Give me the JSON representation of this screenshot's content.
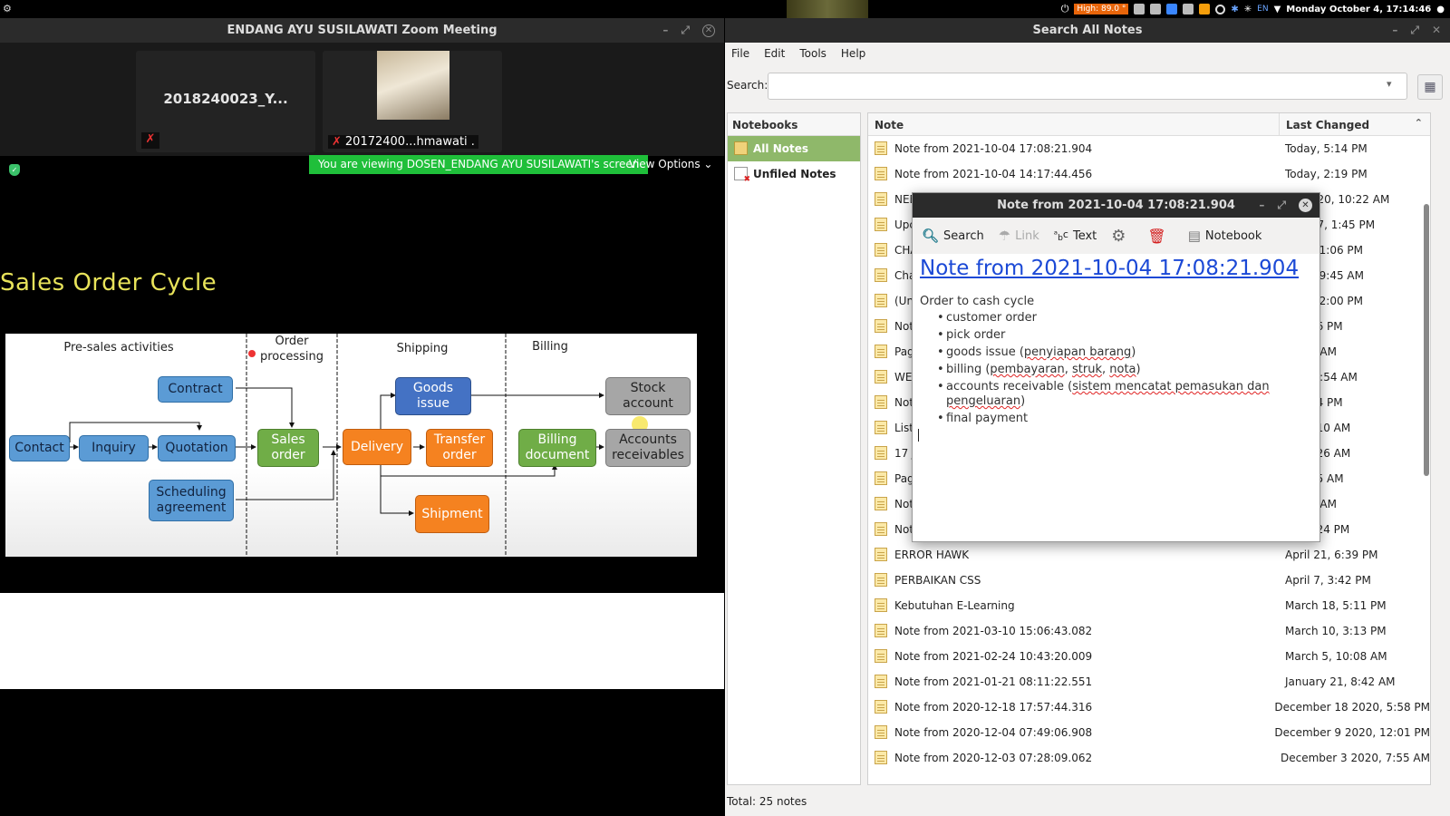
{
  "topbar": {
    "temp": "High: 89.0 °",
    "lang": "EN",
    "clock": "Monday October 4, 17:14:46"
  },
  "zoom": {
    "title": "ENDANG AYU SUSILAWATI  Zoom Meeting",
    "participant1": "2018240023_Y...",
    "participant2": "20172400...hmawati .",
    "viewing_banner": "You are viewing DOSEN_ENDANG AYU SUSILAWATI's screen",
    "view_options": "View Options",
    "slide_title": "Sales Order Cycle"
  },
  "diagram": {
    "lanes": [
      "Pre-sales activities",
      "Order processing",
      "Shipping",
      "Billing"
    ],
    "boxes": {
      "contract": "Contract",
      "contact": "Contact",
      "inquiry": "Inquiry",
      "quotation": "Quotation",
      "scheduling": "Scheduling agreement",
      "sales_order": "Sales order",
      "delivery": "Delivery",
      "goods_issue": "Goods issue",
      "transfer_order": "Transfer order",
      "shipment": "Shipment",
      "billing_doc": "Billing document",
      "stock_account": "Stock account",
      "accounts_recv": "Accounts receivables"
    }
  },
  "notes": {
    "title": "Search All Notes",
    "menu": [
      "File",
      "Edit",
      "Tools",
      "Help"
    ],
    "search_label": "Search:",
    "search_value": "",
    "notebooks_header": "Notebooks",
    "notebooks": [
      "All Notes",
      "Unfiled Notes"
    ],
    "col_note": "Note",
    "col_changed": "Last Changed",
    "rows": [
      {
        "title": "Note from 2021-10-04 17:08:21.904",
        "date": "Today, 5:14 PM"
      },
      {
        "title": "Note from 2021-10-04 14:17:44.456",
        "date": "Today, 2:19 PM"
      },
      {
        "title": "NEE",
        "date": "mber 20, 10:22 AM"
      },
      {
        "title": "Upc",
        "date": "mber 7, 1:45 PM"
      },
      {
        "title": "CHA",
        "date": "st 18, 1:06 PM"
      },
      {
        "title": "Cha",
        "date": "st 12, 9:45 AM"
      },
      {
        "title": "(Un",
        "date": "st 10, 2:00 PM"
      },
      {
        "title": "Not",
        "date": "3, 4:36 PM"
      },
      {
        "title": "Pag",
        "date": "10:54 AM"
      },
      {
        "title": "WE",
        "date": "29, 10:54 AM"
      },
      {
        "title": "Not",
        "date": "9, 8:14 PM"
      },
      {
        "title": "List",
        "date": "8, 11:10 AM"
      },
      {
        "title": "17 J",
        "date": "7, 10:26 AM"
      },
      {
        "title": "Pag",
        "date": "7, 8:35 AM"
      },
      {
        "title": "Not",
        "date": ", 9:33 AM"
      },
      {
        "title": "Not",
        "date": "28, 4:24 PM"
      },
      {
        "title": "ERROR HAWK",
        "date": "April 21, 6:39 PM"
      },
      {
        "title": "PERBAIKAN CSS",
        "date": "April 7, 3:42 PM"
      },
      {
        "title": "Kebutuhan E-Learning",
        "date": "March 18, 5:11 PM"
      },
      {
        "title": "Note from 2021-03-10 15:06:43.082",
        "date": "March 10, 3:13 PM"
      },
      {
        "title": "Note from 2021-02-24 10:43:20.009",
        "date": "March 5, 10:08 AM"
      },
      {
        "title": "Note from 2021-01-21 08:11:22.551",
        "date": "January 21, 8:42 AM"
      },
      {
        "title": "Note from 2020-12-18 17:57:44.316",
        "date": "December 18 2020, 5:58 PM"
      },
      {
        "title": "Note from 2020-12-04 07:49:06.908",
        "date": "December 9 2020, 12:01 PM"
      },
      {
        "title": "Note from 2020-12-03 07:28:09.062",
        "date": "December 3 2020, 7:55 AM"
      }
    ],
    "total": "Total: 25 notes"
  },
  "popup": {
    "title": "Note from 2021-10-04 17:08:21.904",
    "toolbar": {
      "search": "Search",
      "link": "Link",
      "text": "Text",
      "notebook": "Notebook"
    },
    "heading": "Note from 2021-10-04 17:08:21.904",
    "intro": "Order to cash cycle",
    "items": {
      "i1": "customer order",
      "i2": "pick order",
      "i3a": "goods issue (",
      "i3b": "penyiapan barang",
      "i3c": ")",
      "i4a": "billing (",
      "i4b": "pembayaran",
      "i4c": ", ",
      "i4d": "struk",
      "i4e": ", ",
      "i4f": "nota",
      "i4g": ")",
      "i5a": "accounts receivable (",
      "i5b": "sistem mencatat pemasukan dan pengeluaran",
      "i5c": ")",
      "i6": "final payment"
    }
  }
}
